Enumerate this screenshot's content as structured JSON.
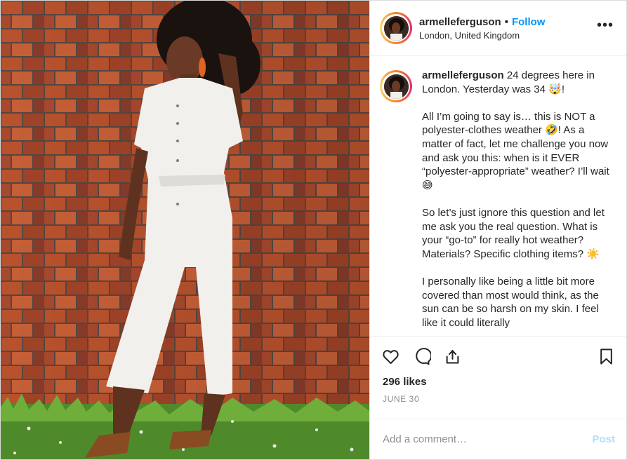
{
  "post": {
    "author": {
      "username": "armelleferguson",
      "location": "London, United Kingdom",
      "follow_label": "Follow",
      "separator": "•"
    },
    "more_label": "•••",
    "caption": {
      "username": "armelleferguson",
      "paragraphs": [
        " 24 degrees here in London. Yesterday was 34 🤯!",
        "All I’m going to say is… this is NOT a polyester-clothes weather 🤣! As a matter of fact, let me challenge you now and ask you this: when is it EVER “polyester-appropriate” weather? I’ll wait 😅",
        "So let’s just ignore this question and let me ask you the real question. What is your “go-to” for really hot weather? Materials? Specific clothing items? ☀️",
        "I personally like being a little bit more covered than most would think, as the sun can be so harsh on my skin. I feel like it could literally"
      ]
    },
    "likes": "296 likes",
    "date": "JUNE 30",
    "comment_placeholder": "Add a comment…",
    "post_button": "Post",
    "icons": [
      "heart-icon",
      "comment-icon",
      "share-icon",
      "bookmark-icon"
    ],
    "colors": {
      "follow": "#0095f6",
      "post_disabled": "#b2dffc",
      "muted": "#8e8e8e",
      "text": "#262626",
      "brick": "#b8512e"
    }
  }
}
